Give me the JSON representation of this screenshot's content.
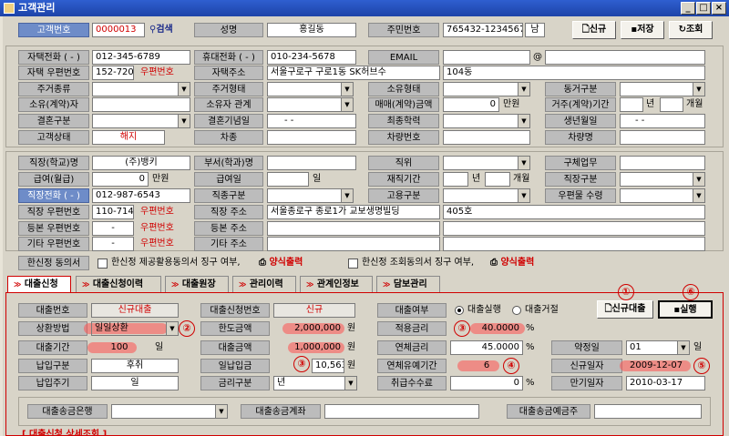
{
  "window": {
    "title": "고객관리"
  },
  "header": {
    "customer_no_label": "고객번호",
    "customer_no": "0000013",
    "search_label": "검색",
    "name_label": "성명",
    "name": "홍길동",
    "rrn_label": "주민번호",
    "rrn": "765432-1234567",
    "gender": "남",
    "new_label": "신규",
    "save_label": "저장",
    "query_label": "조회"
  },
  "personal": {
    "home_phone_label": "자택전화 ( - )",
    "home_phone": "012-345-6789",
    "mobile_label": "휴대전화 ( - )",
    "mobile": "010-234-5678",
    "email_label": "EMAIL",
    "email_at": "@",
    "home_zip_label": "자택 우편번호",
    "home_zip": "152-720",
    "zip_btn": "우편번호",
    "home_addr_label": "자택주소",
    "home_addr": "서울구로구 구로1동 SK허브수",
    "home_addr2": "104동",
    "residence_type_label": "주거종류",
    "residence_form_label": "주거형태",
    "ownership_label": "소유형태",
    "cohabit_label": "동거구분",
    "owner_label": "소유(계약)자",
    "owner_rel_label": "소유자 관계",
    "contract_amt_label": "매매(계약)금액",
    "contract_amt": "0",
    "contract_unit": "만원",
    "residence_period_label": "거주(계약)기간",
    "year_unit": "년",
    "month_unit": "개월",
    "marital_label": "결혼구분",
    "anniversary_label": "결혼기념일",
    "anniversary": "-  -",
    "education_label": "최종학력",
    "birthday_label": "생년월일",
    "birthday": "-  -",
    "status_label": "고객상태",
    "status": "해지",
    "car_type_label": "차종",
    "car_no_label": "차량번호",
    "car_name_label": "차량명"
  },
  "job": {
    "company_label": "직장(학교)명",
    "company": "(주)뱅키",
    "dept_label": "부서(학과)명",
    "position_label": "직위",
    "duty_label": "구체업무",
    "salary_label": "급여(월급)",
    "salary": "0",
    "salary_unit": "만원",
    "payday_label": "급여일",
    "payday_unit": "일",
    "tenure_label": "재직기간",
    "tenure_year_unit": "년",
    "tenure_month_unit": "개월",
    "job_type_label": "직장구분",
    "work_phone_label": "직장전화 ( - )",
    "work_phone": "012-987-6543",
    "job_class_label": "직종구분",
    "employ_label": "고용구분",
    "mail_recv_label": "우편물 수령",
    "work_zip_label": "직장 우편번호",
    "work_zip": "110-714",
    "work_zip_btn": "우편번호",
    "work_addr_label": "직장 주소",
    "work_addr": "서울종로구 종로1가 교보생명빌딩",
    "work_addr2": "405호",
    "reg_zip_label": "등본 우편번호",
    "reg_zip": "-",
    "reg_zip_btn": "우편번호",
    "reg_addr_label": "등본 주소",
    "etc_zip_label": "기타 우편번호",
    "etc_zip": "-",
    "etc_zip_btn": "우편번호",
    "etc_addr_label": "기타 주소"
  },
  "consent": {
    "label": "한신정 동의서",
    "check1": "한신정 제공활용동의서 징구 여부,",
    "print1": "양식출력",
    "check2": "한신정 조회동의서 징구 여부,",
    "print2": "양식출력"
  },
  "tabs": [
    {
      "label": "대출신청",
      "active": true
    },
    {
      "label": "대출신청이력",
      "active": false
    },
    {
      "label": "대출원장",
      "active": false
    },
    {
      "label": "관리이력",
      "active": false
    },
    {
      "label": "관계인정보",
      "active": false
    },
    {
      "label": "담보관리",
      "active": false
    }
  ],
  "loan": {
    "loan_no_label": "대출번호",
    "loan_no": "신규대출",
    "app_no_label": "대출신청번호",
    "app_no": "신규",
    "exec_label": "대출여부",
    "exec_option": "대출실행",
    "reject_option": "대출거절",
    "new_loan_btn": "신규대출",
    "exec_btn": "실행",
    "repay_label": "상환방법",
    "repay": "일일상환",
    "limit_label": "한도금액",
    "limit": "2,000,000",
    "won": "원",
    "rate_label": "적용금리",
    "rate": "40.0000",
    "pct": "%",
    "period_label": "대출기간",
    "period": "100",
    "day_unit": "일",
    "amount_label": "대출금액",
    "amount": "1,000,000",
    "overdue_rate_label": "연체금리",
    "overdue_rate": "45.0000",
    "agree_day_label": "약정일",
    "agree_day": "01",
    "agree_day_unit": "일",
    "pay_type_label": "납입구분",
    "pay_type": "후취",
    "daily_pay_label": "일납입금",
    "daily_pay": "10,563",
    "grace_label": "연체유예기간",
    "grace": "6",
    "new_date_label": "신규일자",
    "new_date": "2009-12-07",
    "pay_cycle_label": "납입주기",
    "pay_cycle": "일",
    "rate_type_label": "금리구분",
    "rate_type": "년",
    "fee_label": "취급수수료",
    "fee": "0",
    "maturity_label": "만기일자",
    "maturity": "2010-03-17",
    "bank_label": "대출송금은행",
    "account_label": "대출송금계좌",
    "holder_label": "대출송금예금주"
  },
  "annotations": [
    "①",
    "②",
    "③",
    "③",
    "④",
    "⑤",
    "⑥"
  ],
  "footer": {
    "partial": "[ 대출신청 상세조회 ]"
  }
}
